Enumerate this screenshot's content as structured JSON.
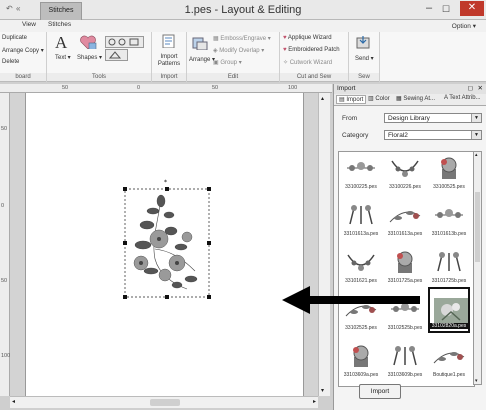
{
  "window": {
    "title": "1.pes - Layout & Editing",
    "context_tab": "Stitches",
    "quick_access": [
      "undo",
      "redo"
    ],
    "controls": [
      "minimize",
      "maximize",
      "close"
    ]
  },
  "tabs": [
    "View",
    "Stitches"
  ],
  "option_menu": "Option",
  "ribbon": {
    "clipboard": {
      "items": [
        "Duplicate",
        "Arrange Copy",
        "Delete"
      ],
      "label": "board"
    },
    "tools": {
      "text": "Text",
      "shapes": "Shapes",
      "label": "Tools"
    },
    "import": {
      "button": "Import Patterns",
      "label": "Import"
    },
    "edit": {
      "arrange": "Arrange",
      "items": [
        "Emboss/Engrave",
        "Modify Overlap",
        "Group"
      ],
      "label": "Edit"
    },
    "cut_and_sew": {
      "items": [
        "Applique Wizard",
        "Embroidered Patch",
        "Cutwork Wizard"
      ],
      "label": "Cut and Sew"
    },
    "sew": {
      "button": "Send",
      "label": "Sew"
    }
  },
  "ruler": {
    "h_ticks": [
      "50",
      "0",
      "50",
      "100"
    ],
    "v_ticks": [
      "50",
      "0",
      "50",
      "100"
    ]
  },
  "panel": {
    "title": "Import",
    "tabs": [
      "Import",
      "Color",
      "Sewing At...",
      "Text Attrib..."
    ],
    "from_label": "From",
    "from_value": "Design Library",
    "category_label": "Category",
    "category_value": "Floral2",
    "thumbnails": [
      {
        "caption": "33100225.pes"
      },
      {
        "caption": "33100226.pes"
      },
      {
        "caption": "33100525.pes"
      },
      {
        "caption": "33101613a.pes"
      },
      {
        "caption": "33101613a.pes"
      },
      {
        "caption": "33101613b.pes"
      },
      {
        "caption": "33101621.pes"
      },
      {
        "caption": "33101725a.pes"
      },
      {
        "caption": "33101725b.pes"
      },
      {
        "caption": "33102525.pes"
      },
      {
        "caption": "33102525b.pes"
      },
      {
        "caption": "33102820a.pes"
      },
      {
        "caption": "33103609a.pes"
      },
      {
        "caption": "33103609b.pes"
      },
      {
        "caption": "Boutique1.pes"
      }
    ],
    "selected_index": 11,
    "import_button": "Import"
  },
  "colors": {
    "accent": "#c0392b",
    "arrow": "#000000"
  }
}
